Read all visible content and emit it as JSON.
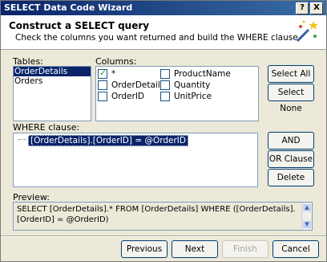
{
  "window": {
    "title": "SELECT Data Code Wizard",
    "help": "?",
    "close": "X"
  },
  "header": {
    "title": "Construct a SELECT query",
    "subtitle": "Check the columns you want returned and build the WHERE clause.",
    "icon": "wizard-wand-icon"
  },
  "tables": {
    "label": "Tables:",
    "items": [
      "OrderDetails",
      "Orders"
    ],
    "selected": "OrderDetails"
  },
  "columns": {
    "label": "Columns:",
    "items": [
      {
        "label": "*",
        "checked": true
      },
      {
        "label": "OrderDetailID",
        "checked": false
      },
      {
        "label": "OrderID",
        "checked": false
      },
      {
        "label": "ProductName",
        "checked": false
      },
      {
        "label": "Quantity",
        "checked": false
      },
      {
        "label": "UnitPrice",
        "checked": false
      }
    ]
  },
  "buttons": {
    "select_all": "Select All",
    "select_none": "Select None",
    "and_clause": "AND Clause",
    "or_clause": "OR Clause",
    "delete": "Delete",
    "previous": "Previous",
    "next": "Next",
    "finish": "Finish",
    "cancel": "Cancel"
  },
  "where": {
    "label": "WHERE clause:",
    "item": "[OrderDetails].[OrderID] = @OrderID"
  },
  "preview": {
    "label": "Preview:",
    "text": "SELECT [OrderDetails].* FROM [OrderDetails] WHERE ([OrderDetails].[OrderID] = @OrderID)"
  }
}
